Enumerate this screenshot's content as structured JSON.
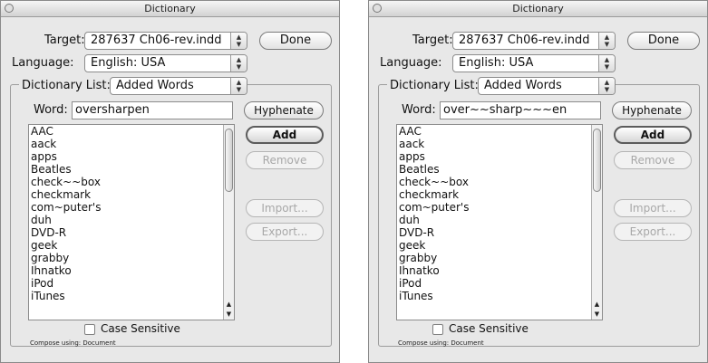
{
  "panels": {
    "left": {
      "window_title": "Dictionary",
      "target_label": "Target:",
      "target_value": "287637 Ch06-rev.indd",
      "language_label": "Language:",
      "language_value": "English: USA",
      "dictionary_list_label": "Dictionary List:",
      "dictionary_list_value": "Added Words",
      "word_label": "Word:",
      "word_value": "oversharpen",
      "buttons": {
        "done": "Done",
        "hyphenate": "Hyphenate",
        "add": "Add",
        "remove": "Remove",
        "import": "Import...",
        "export": "Export..."
      },
      "words": [
        "AAC",
        "aack",
        "apps",
        "Beatles",
        "check~~box",
        "checkmark",
        "com~puter's",
        "duh",
        "DVD-R",
        "geek",
        "grabby",
        "Ihnatko",
        "iPod",
        "iTunes"
      ],
      "case_sensitive_label": "Case Sensitive",
      "case_sensitive_checked": false,
      "compose_label": "Compose using: Document"
    },
    "right": {
      "window_title": "Dictionary",
      "target_label": "Target:",
      "target_value": "287637 Ch06-rev.indd",
      "language_label": "Language:",
      "language_value": "English: USA",
      "dictionary_list_label": "Dictionary List:",
      "dictionary_list_value": "Added Words",
      "word_label": "Word:",
      "word_value": "over~~sharp~~~en",
      "buttons": {
        "done": "Done",
        "hyphenate": "Hyphenate",
        "add": "Add",
        "remove": "Remove",
        "import": "Import...",
        "export": "Export..."
      },
      "words": [
        "AAC",
        "aack",
        "apps",
        "Beatles",
        "check~~box",
        "checkmark",
        "com~puter's",
        "duh",
        "DVD-R",
        "geek",
        "grabby",
        "Ihnatko",
        "iPod",
        "iTunes"
      ],
      "case_sensitive_label": "Case Sensitive",
      "case_sensitive_checked": false,
      "compose_label": "Compose using: Document"
    }
  }
}
